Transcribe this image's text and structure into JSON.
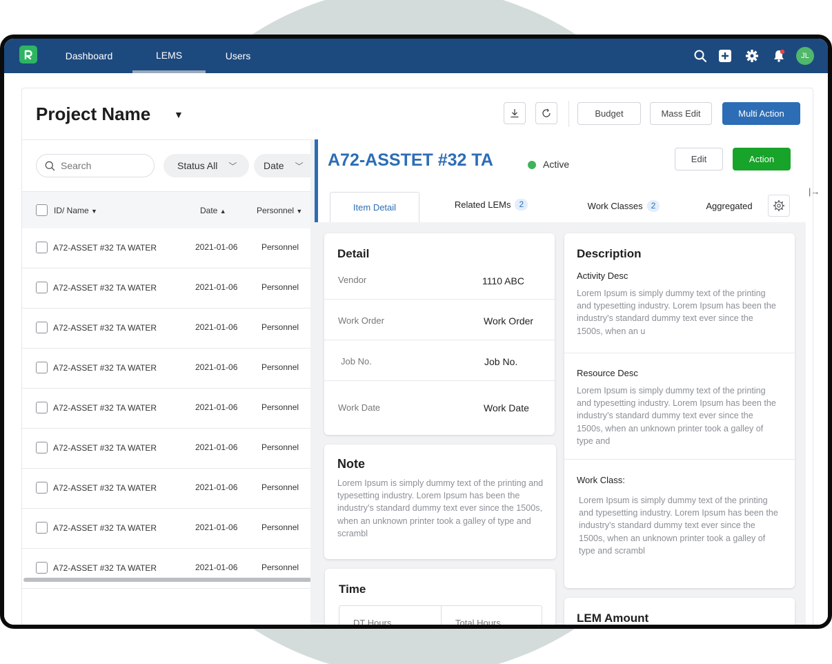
{
  "app": {
    "logo_letter": "R",
    "nav": [
      {
        "label": "Dashboard"
      },
      {
        "label": "LEMS"
      },
      {
        "label": "Users"
      }
    ],
    "user_initials": "JL",
    "colors": {
      "topbar": "#1d4a7e",
      "primary": "#2c6db5",
      "success": "#18a32a"
    }
  },
  "header": {
    "project_name": "Project Name",
    "buttons": {
      "budget": "Budget",
      "mass_edit": "Mass Edit",
      "multi_action": "Multi Action"
    },
    "icons": [
      "download-icon",
      "refresh-icon"
    ]
  },
  "filters": {
    "search_placeholder": "Search",
    "status": "Status All",
    "date": "Date"
  },
  "table": {
    "columns": {
      "name": "ID/ Name",
      "date": "Date",
      "personnel": "Personnel"
    },
    "rows": [
      {
        "name": "A72-ASSET #32 TA WATER",
        "date": "2021-01-06",
        "personnel": "Personnel"
      },
      {
        "name": "A72-ASSET #32 TA WATER",
        "date": "2021-01-06",
        "personnel": "Personnel"
      },
      {
        "name": "A72-ASSET #32 TA WATER",
        "date": "2021-01-06",
        "personnel": "Personnel"
      },
      {
        "name": "A72-ASSET #32 TA WATER",
        "date": "2021-01-06",
        "personnel": "Personnel"
      },
      {
        "name": "A72-ASSET #32 TA WATER",
        "date": "2021-01-06",
        "personnel": "Personnel"
      },
      {
        "name": "A72-ASSET #32 TA WATER",
        "date": "2021-01-06",
        "personnel": "Personnel"
      },
      {
        "name": "A72-ASSET #32 TA WATER",
        "date": "2021-01-06",
        "personnel": "Personnel"
      },
      {
        "name": "A72-ASSET #32 TA WATER",
        "date": "2021-01-06",
        "personnel": "Personnel"
      },
      {
        "name": "A72-ASSET #32 TA WATER",
        "date": "2021-01-06",
        "personnel": "Personnel"
      }
    ]
  },
  "detail": {
    "title": "A72-ASSTET #32 TA",
    "status": "Active",
    "edit_label": "Edit",
    "action_label": "Action",
    "tabs": [
      {
        "label": "Item Detail",
        "badge": ""
      },
      {
        "label": "Related LEMs",
        "badge": "2"
      },
      {
        "label": "Work Classes",
        "badge": "2"
      },
      {
        "label": "Aggregated",
        "badge": ""
      }
    ],
    "detail_card": {
      "title": "Detail",
      "fields": [
        {
          "label": "Vendor",
          "value": "1110 ABC"
        },
        {
          "label": "Work Order",
          "value": "Work Order"
        },
        {
          "label": "Job No.",
          "value": "Job No."
        },
        {
          "label": "Work Date",
          "value": "Work Date"
        }
      ]
    },
    "note_card": {
      "title": "Note",
      "text": "Lorem Ipsum is simply dummy text of the printing and typesetting industry. Lorem Ipsum has been the industry's standard dummy text ever since the 1500s, when an unknown printer took a galley of type and scrambl"
    },
    "time_card": {
      "title": "Time",
      "col1": "DT Hours",
      "col2": "Total Hours"
    },
    "description_card": {
      "title": "Description",
      "sections": [
        {
          "label": "Activity Desc",
          "text": "Lorem Ipsum is simply dummy text of the printing and typesetting industry. Lorem Ipsum has been the industry's standard dummy text ever since the 1500s, when an u"
        },
        {
          "label": "Resource Desc",
          "text": "Lorem Ipsum is simply dummy text of the printing and typesetting industry. Lorem Ipsum has been the industry's standard dummy text ever since the 1500s, when an unknown printer took a galley of type and"
        },
        {
          "label": "Work Class:",
          "text": "Lorem Ipsum is simply dummy text of the printing and typesetting industry. Lorem Ipsum has been the industry's standard dummy text ever since the 1500s, when an unknown printer took a galley of type and scrambl"
        }
      ]
    },
    "lem_amount_card": {
      "title": "LEM Amount"
    }
  }
}
